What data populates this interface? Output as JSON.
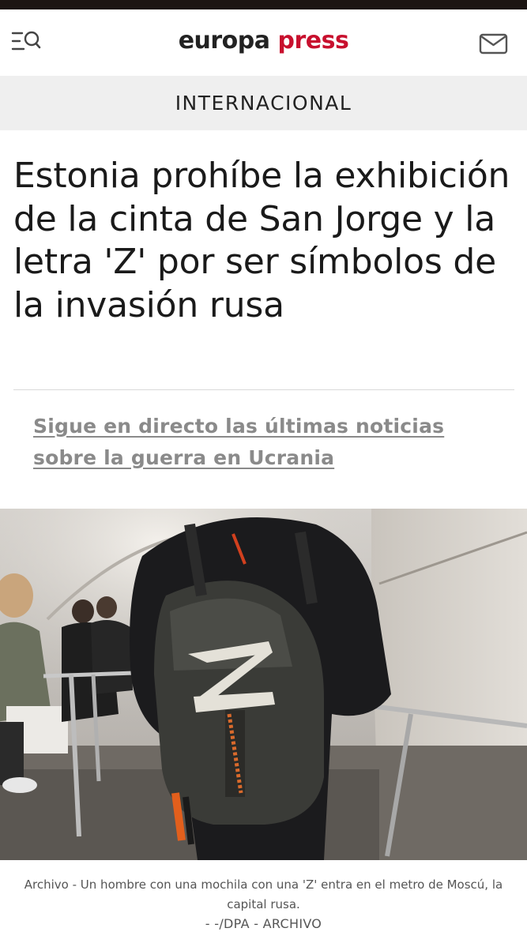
{
  "header": {
    "logo_part1": "europa",
    "logo_part2": "press",
    "menu_icon": "menu-search-icon",
    "mail_icon": "mail-icon",
    "brand_color": "#c8102e"
  },
  "section": {
    "label": "INTERNACIONAL"
  },
  "article": {
    "headline": "Estonia prohíbe la exhibición de la cinta de San Jorge y la letra 'Z' por ser símbolos de la invasión rusa",
    "live_link": "Sigue en directo las últimas noticias sobre la guerra en Ucrania",
    "image_caption": "Archivo - Un hombre con una mochila con una 'Z' entra en el metro de Moscú, la capital rusa.",
    "image_credit": "- -/DPA - ARCHIVO"
  }
}
